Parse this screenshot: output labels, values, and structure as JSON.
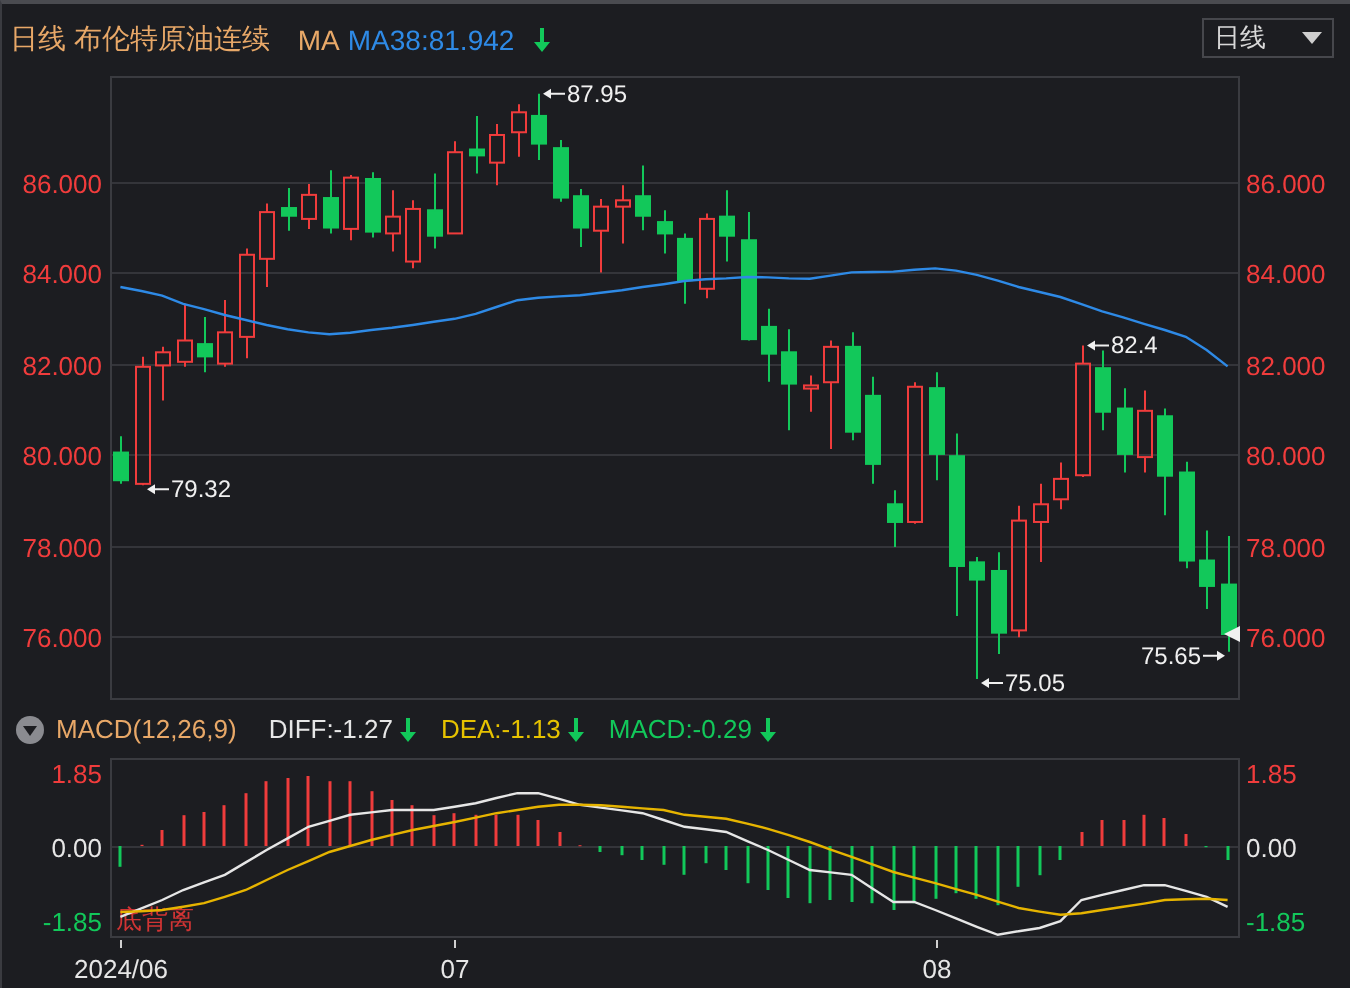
{
  "header": {
    "title": "日线 布伦特原油连续",
    "indicator_label": "MA",
    "indicators": [
      {
        "text": "MA38:81.942",
        "color": "#2e8ae6",
        "down": true
      }
    ],
    "period_button": "日线"
  },
  "price_chart": {
    "chart_data": {
      "type": "candlestick",
      "grid": true,
      "categories": [
        null,
        null,
        null,
        null,
        null,
        null,
        null,
        null,
        null,
        null,
        null,
        null,
        null,
        null,
        null,
        null,
        null,
        null,
        null,
        null,
        null,
        null,
        null,
        null,
        null,
        null,
        null,
        null,
        null,
        null,
        null,
        null,
        null,
        null,
        null,
        null,
        null,
        null,
        null,
        null,
        null,
        null,
        null,
        null,
        null,
        null,
        null,
        null,
        null,
        null,
        null,
        null,
        null,
        null
      ],
      "ylim": [
        74.63,
        88.34
      ],
      "yticks": [
        {
          "value": 76,
          "label": "76.000"
        },
        {
          "value": 78,
          "label": "78.000"
        },
        {
          "value": 80,
          "label": "80.000"
        },
        {
          "value": 82,
          "label": "82.000"
        },
        {
          "value": 84,
          "label": "84.000"
        },
        {
          "value": 86,
          "label": "86.000"
        }
      ],
      "ohlc": [
        [
          80.04,
          80.4,
          79.35,
          79.43
        ],
        [
          79.35,
          82.15,
          79.32,
          81.93
        ],
        [
          81.96,
          82.37,
          81.19,
          82.25
        ],
        [
          82.04,
          83.32,
          81.93,
          82.51
        ],
        [
          82.43,
          83.03,
          81.81,
          82.16
        ],
        [
          82.0,
          83.4,
          81.93,
          82.69
        ],
        [
          82.59,
          84.54,
          82.12,
          84.4
        ],
        [
          84.31,
          85.53,
          83.69,
          85.34
        ],
        [
          85.43,
          85.87,
          84.93,
          85.26
        ],
        [
          85.19,
          85.96,
          84.97,
          85.72
        ],
        [
          85.65,
          86.26,
          84.87,
          85.0
        ],
        [
          84.97,
          86.16,
          84.72,
          86.1
        ],
        [
          86.07,
          86.22,
          84.78,
          84.91
        ],
        [
          84.87,
          85.82,
          84.47,
          85.24
        ],
        [
          84.25,
          85.6,
          84.1,
          85.41
        ],
        [
          85.38,
          86.19,
          84.54,
          84.82
        ],
        [
          84.87,
          86.9,
          84.87,
          86.66
        ],
        [
          86.72,
          87.46,
          86.19,
          86.59
        ],
        [
          86.43,
          87.28,
          85.93,
          87.04
        ],
        [
          87.1,
          87.72,
          86.56,
          87.54
        ],
        [
          87.46,
          87.95,
          86.49,
          86.85
        ],
        [
          86.75,
          86.93,
          85.57,
          85.66
        ],
        [
          85.69,
          85.85,
          84.57,
          85.0
        ],
        [
          84.93,
          85.63,
          84.01,
          85.46
        ],
        [
          85.46,
          85.93,
          84.65,
          85.6
        ],
        [
          85.69,
          86.37,
          84.94,
          85.26
        ],
        [
          85.12,
          85.38,
          84.43,
          84.87
        ],
        [
          84.75,
          84.87,
          83.32,
          83.84
        ],
        [
          83.65,
          85.31,
          83.44,
          85.19
        ],
        [
          85.24,
          85.82,
          84.25,
          84.82
        ],
        [
          84.72,
          85.34,
          82.51,
          82.54
        ],
        [
          82.81,
          83.21,
          81.6,
          82.22
        ],
        [
          82.25,
          82.76,
          80.53,
          81.56
        ],
        [
          81.45,
          81.74,
          80.94,
          81.52
        ],
        [
          81.59,
          82.51,
          80.12,
          82.37
        ],
        [
          82.37,
          82.69,
          80.31,
          80.5
        ],
        [
          81.29,
          81.71,
          79.35,
          79.79
        ],
        [
          78.9,
          79.21,
          77.96,
          78.51
        ],
        [
          78.51,
          81.59,
          78.47,
          81.49
        ],
        [
          81.46,
          81.81,
          79.43,
          80.01
        ],
        [
          79.96,
          80.46,
          76.44,
          77.54
        ],
        [
          77.62,
          77.74,
          75.05,
          77.24
        ],
        [
          77.43,
          77.84,
          75.6,
          76.07
        ],
        [
          76.12,
          78.87,
          75.97,
          78.54
        ],
        [
          78.51,
          79.35,
          77.63,
          78.9
        ],
        [
          79.01,
          79.82,
          78.79,
          79.46
        ],
        [
          79.54,
          82.4,
          79.5,
          82.0
        ],
        [
          81.9,
          82.29,
          80.53,
          80.94
        ],
        [
          81.01,
          81.46,
          79.6,
          80.01
        ],
        [
          79.94,
          81.41,
          79.6,
          80.96
        ],
        [
          80.84,
          81.01,
          78.66,
          79.53
        ],
        [
          79.6,
          79.84,
          77.49,
          77.66
        ],
        [
          77.66,
          78.32,
          76.59,
          77.1
        ],
        [
          77.13,
          78.2,
          75.65,
          76.04
        ]
      ],
      "annotations": [
        "79.32",
        "87.95",
        "75.05",
        "82.4",
        "75.65"
      ]
    },
    "ma_line": {
      "chart_data": {
        "type": "line",
        "categories": [
          null,
          null,
          null,
          null,
          null,
          null,
          null,
          null,
          null,
          null,
          null,
          null,
          null,
          null,
          null,
          null,
          null,
          null,
          null,
          null,
          null,
          null,
          null,
          null,
          null,
          null,
          null,
          null,
          null,
          null,
          null,
          null,
          null,
          null,
          null,
          null,
          null,
          null,
          null,
          null,
          null,
          null,
          null,
          null,
          null,
          null,
          null,
          null,
          null,
          null,
          null,
          null,
          null,
          null
        ],
        "ylim": [
          74.63,
          88.34
        ],
        "yticks": [
          {
            "value": 76,
            "label": "76.000"
          },
          {
            "value": 78,
            "label": "78.000"
          },
          {
            "value": 80,
            "label": "80.000"
          },
          {
            "value": 82,
            "label": "82.000"
          },
          {
            "value": 84,
            "label": "84.000"
          },
          {
            "value": 86,
            "label": "86.000"
          }
        ],
        "series": [
          {
            "color": "#2e8ae6",
            "values": [
              83.69,
              83.6,
              83.5,
              83.32,
              83.2,
              83.07,
              82.96,
              82.85,
              82.76,
              82.69,
              82.65,
              82.68,
              82.74,
              82.79,
              82.85,
              82.92,
              82.99,
              83.1,
              83.25,
              83.4,
              83.45,
              83.48,
              83.51,
              83.56,
              83.62,
              83.69,
              83.75,
              83.82,
              83.86,
              83.88,
              83.91,
              83.9,
              83.88,
              83.87,
              83.94,
              84.01,
              84.02,
              84.03,
              84.07,
              84.1,
              84.05,
              83.96,
              83.83,
              83.69,
              83.58,
              83.47,
              83.31,
              83.15,
              83.02,
              82.88,
              82.74,
              82.59,
              82.3,
              81.94
            ]
          }
        ]
      }
    }
  },
  "macd_header": {
    "label": "MACD(12,26,9)",
    "indicators": [
      {
        "text": "DIFF:-1.27",
        "color": "#e6e6e6",
        "down": true
      },
      {
        "text": "DEA:-1.13",
        "color": "#e6c200",
        "down": true
      },
      {
        "text": "MACD:-0.29",
        "color": "#12c85a",
        "down": true
      }
    ]
  },
  "macd_chart": {
    "histogram": {
      "chart_data": {
        "type": "bar",
        "stacked": true,
        "categories": [
          "2024/06",
          null,
          null,
          null,
          null,
          null,
          null,
          null,
          null,
          null,
          null,
          null,
          null,
          null,
          null,
          null,
          "07",
          null,
          null,
          null,
          null,
          null,
          null,
          null,
          null,
          null,
          null,
          null,
          null,
          null,
          null,
          null,
          null,
          null,
          null,
          null,
          null,
          null,
          null,
          "08",
          null,
          null,
          null,
          null,
          null,
          null,
          null,
          null,
          null,
          null,
          null,
          null,
          null,
          null
        ],
        "ylim": [
          -2.25,
          2.2
        ],
        "yticks": [
          {
            "value": 1.85,
            "label": "1.85"
          },
          {
            "value": 0,
            "label": "0.00"
          },
          {
            "value": -1.85,
            "label": "-1.85"
          }
        ],
        "series": [
          {
            "color": "#f03c3c",
            "values": [
              null,
              0.03,
              0.4,
              0.77,
              0.85,
              1.02,
              1.32,
              1.62,
              1.7,
              1.75,
              1.62,
              1.62,
              1.37,
              1.15,
              1.02,
              0.77,
              0.82,
              0.78,
              0.78,
              0.78,
              0.65,
              0.35,
              0.02,
              null,
              null,
              null,
              null,
              null,
              null,
              null,
              null,
              null,
              null,
              null,
              null,
              null,
              null,
              null,
              null,
              null,
              null,
              null,
              null,
              null,
              null,
              null,
              0.35,
              0.65,
              0.65,
              0.78,
              0.7,
              0.3,
              null,
              null
            ]
          },
          {
            "color": "#12c85a",
            "values": [
              -0.52,
              null,
              null,
              null,
              null,
              null,
              null,
              null,
              null,
              null,
              null,
              null,
              null,
              null,
              null,
              null,
              null,
              null,
              null,
              null,
              null,
              null,
              null,
              -0.15,
              -0.23,
              -0.35,
              -0.47,
              -0.72,
              -0.43,
              -0.6,
              -0.93,
              -1.1,
              -1.3,
              -1.43,
              -1.35,
              -1.4,
              -1.43,
              -1.6,
              -1.43,
              -1.32,
              -1.18,
              -1.32,
              -1.48,
              -1.02,
              -0.73,
              -0.35,
              null,
              null,
              null,
              null,
              null,
              null,
              -0.03,
              -0.35
            ]
          }
        ],
        "annotations": [
          "底背离"
        ]
      }
    },
    "lines": {
      "chart_data": {
        "type": "line",
        "categories": [
          null,
          null,
          null,
          null,
          null,
          null,
          null,
          null,
          null,
          null,
          null,
          null,
          null,
          null,
          null,
          null,
          null,
          null,
          null,
          null,
          null,
          null,
          null,
          null,
          null,
          null,
          null,
          null,
          null,
          null,
          null,
          null,
          null,
          null,
          null,
          null,
          null,
          null,
          null,
          null,
          null,
          null,
          null,
          null,
          null,
          null,
          null,
          null,
          null,
          null,
          null,
          null,
          null,
          null
        ],
        "ylim": [
          -2.25,
          2.2
        ],
        "yticks": [
          {
            "value": 1.85,
            "label": "1.85"
          },
          {
            "value": 0,
            "label": "0.00"
          },
          {
            "value": -1.85,
            "label": "-1.85"
          }
        ],
        "series": [
          {
            "color": "#e6e6e6",
            "values": [
              -1.77,
              -1.56,
              -1.35,
              -1.1,
              -0.91,
              -0.72,
              -0.41,
              -0.1,
              0.19,
              0.48,
              0.63,
              0.78,
              0.84,
              0.9,
              0.9,
              0.9,
              0.98,
              1.07,
              1.2,
              1.32,
              1.32,
              1.18,
              1.03,
              0.96,
              0.89,
              0.82,
              0.65,
              0.48,
              0.42,
              0.35,
              0.12,
              -0.1,
              -0.35,
              -0.6,
              -0.66,
              -0.72,
              -1.06,
              -1.4,
              -1.4,
              -1.6,
              -1.81,
              -2.02,
              -2.22,
              -2.13,
              -2.05,
              -1.88,
              -1.35,
              -1.22,
              -1.1,
              -0.98,
              -0.98,
              -1.12,
              -1.27,
              -1.52
            ]
          },
          {
            "color": "#e6b400",
            "values": [
              -1.65,
              -1.63,
              -1.6,
              -1.52,
              -1.43,
              -1.27,
              -1.1,
              -0.85,
              -0.6,
              -0.38,
              -0.15,
              0.0,
              0.15,
              0.28,
              0.4,
              0.5,
              0.6,
              0.71,
              0.82,
              0.9,
              0.98,
              1.03,
              1.03,
              1.02,
              0.98,
              0.94,
              0.9,
              0.78,
              0.73,
              0.68,
              0.56,
              0.43,
              0.27,
              0.1,
              -0.09,
              -0.27,
              -0.46,
              -0.65,
              -0.79,
              -0.93,
              -1.08,
              -1.22,
              -1.39,
              -1.55,
              -1.64,
              -1.72,
              -1.68,
              -1.6,
              -1.52,
              -1.44,
              -1.35,
              -1.33,
              -1.32,
              -1.35
            ]
          }
        ]
      }
    }
  }
}
